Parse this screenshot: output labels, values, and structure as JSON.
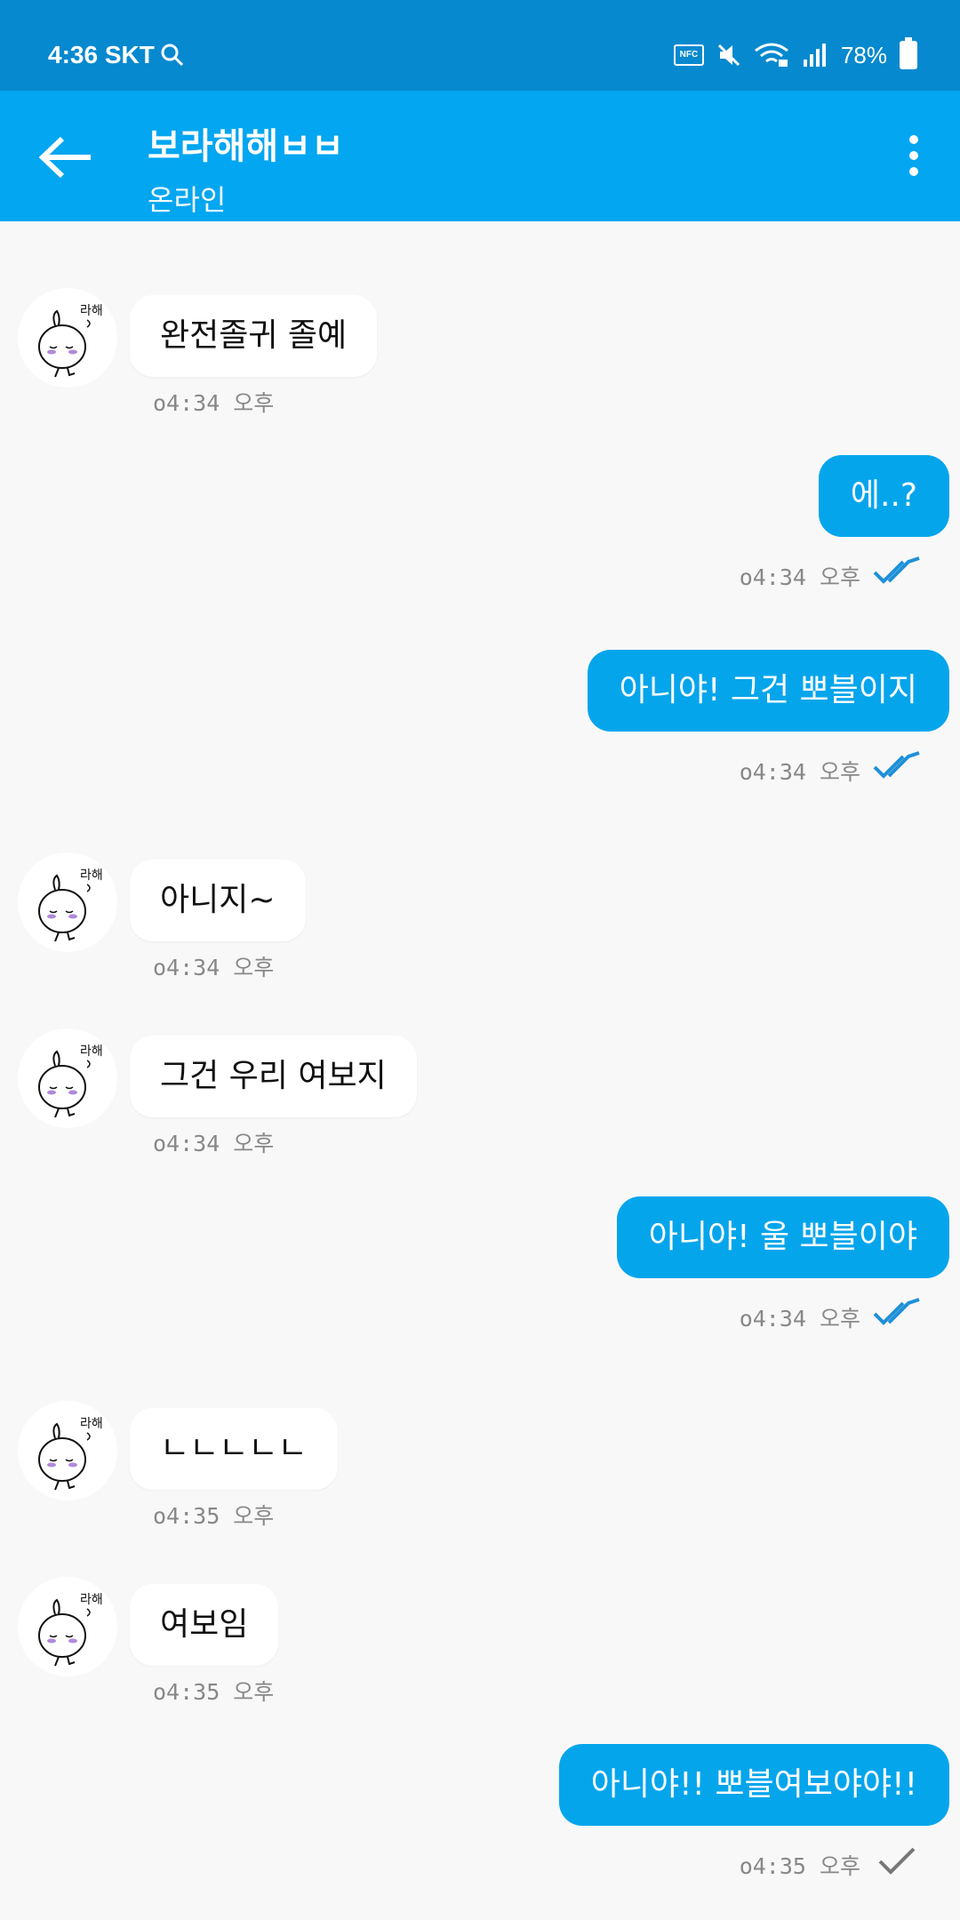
{
  "status_bar": {
    "time": "4:36 SKT",
    "nfc": "NFC",
    "battery": "78%"
  },
  "header": {
    "title": "보라해해ㅂㅂ",
    "status": "온라인"
  },
  "messages": [
    {
      "dir": "in",
      "text": "완전졸귀 졸예",
      "time": "о4:34 오후"
    },
    {
      "dir": "out",
      "text": "에..?",
      "time": "о4:34 오후",
      "read": "double"
    },
    {
      "dir": "out",
      "text": "아니야! 그건 뽀블이지",
      "time": "о4:34 오후",
      "read": "double"
    },
    {
      "dir": "in",
      "text": "아니지~",
      "time": "о4:34 오후"
    },
    {
      "dir": "in",
      "text": "그건 우리 여보지",
      "time": "о4:34 오후"
    },
    {
      "dir": "out",
      "text": "아니야! 울 뽀블이야",
      "time": "о4:34 오후",
      "read": "double"
    },
    {
      "dir": "in",
      "text": "ㄴㄴㄴㄴㄴ",
      "time": "о4:35 오후"
    },
    {
      "dir": "in",
      "text": "여보임",
      "time": "о4:35 오후"
    },
    {
      "dir": "out",
      "text": "아니야!! 뽀블여보야야!!",
      "time": "о4:35 오후",
      "read": "single"
    }
  ],
  "colors": {
    "status_bar": "#0789cf",
    "app_bar": "#03a6f0",
    "outgoing_bubble": "#05a5ec",
    "incoming_bubble": "#ffffff",
    "read_check": "#1e90d8",
    "sent_check": "#777777"
  }
}
